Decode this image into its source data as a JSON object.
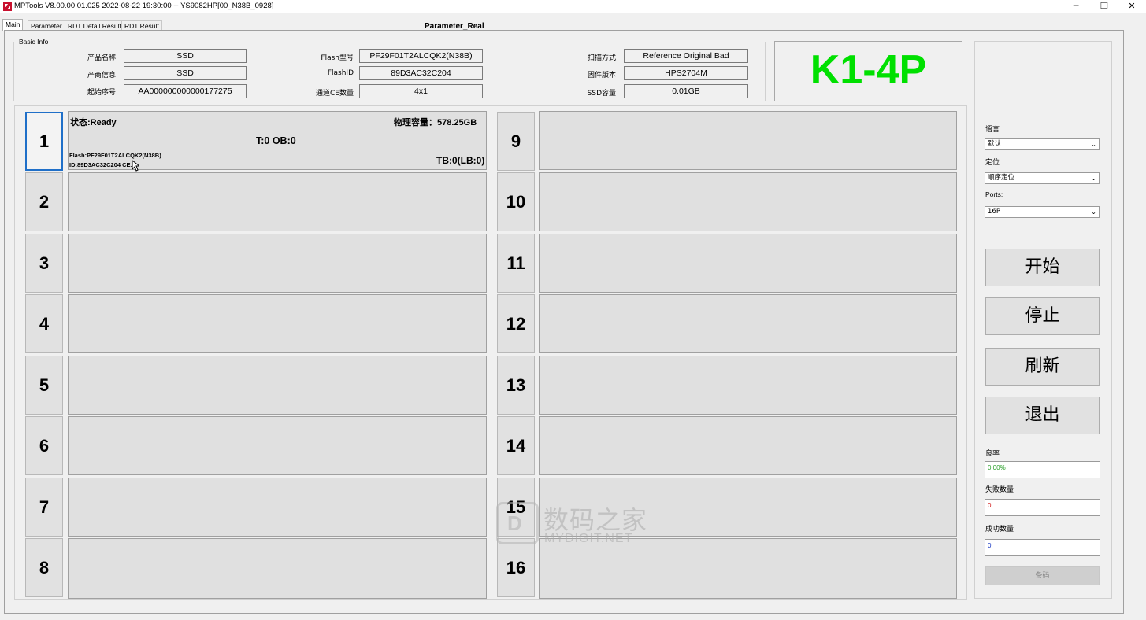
{
  "window": {
    "title": "MPTools V8.00.00.01.025 2022-08-22 19:30:00  -- YS9082HP[00_N38B_0928]",
    "minimize": "─",
    "restore": "❐",
    "close": "✕"
  },
  "tabs": [
    {
      "label": "Main",
      "active": true
    },
    {
      "label": "Parameter",
      "active": false
    },
    {
      "label": "RDT Detail Result",
      "active": false
    },
    {
      "label": "RDT Result",
      "active": false
    }
  ],
  "param_title": "Parameter_Real",
  "basic_info": {
    "legend": "Basic Info",
    "fields": [
      {
        "label": "产品名称",
        "value": "SSD"
      },
      {
        "label": "产商信息",
        "value": "SSD"
      },
      {
        "label": "起始序号",
        "value": "AA000000000000177275"
      },
      {
        "label": "Flash型号",
        "value": "PF29F01T2ALCQK2(N38B)"
      },
      {
        "label": "FlashID",
        "value": "89D3AC32C204"
      },
      {
        "label": "通道CE数量",
        "value": "4x1"
      },
      {
        "label": "扫描方式",
        "value": "Reference Original Bad"
      },
      {
        "label": "固件版本",
        "value": "HPS2704M"
      },
      {
        "label": "SSD容量",
        "value": "0.01GB"
      }
    ]
  },
  "big_label": {
    "text": "K1-4P",
    "color": "#00e000"
  },
  "ports": {
    "numbers": [
      "1",
      "2",
      "3",
      "4",
      "5",
      "6",
      "7",
      "8",
      "9",
      "10",
      "11",
      "12",
      "13",
      "14",
      "15",
      "16"
    ],
    "port1": {
      "status": "状态:Ready",
      "capacity": "物理容量：578.25GB",
      "t_ob": "T:0 OB:0",
      "flash": "Flash:PF29F01T2ALCQK2(N38B)",
      "id": "ID:89D3AC32C204 CE:4",
      "tb": "TB:0(LB:0)"
    }
  },
  "right_panel": {
    "language_label": "语言",
    "language_value": "默认",
    "locate_label": "定位",
    "locate_value": "顺序定位",
    "ports_label": "Ports:",
    "ports_value": "16P",
    "buttons": {
      "start": "开始",
      "stop": "停止",
      "refresh": "刷新",
      "exit": "退出"
    },
    "yield_label": "良率",
    "yield_value": "0.00%",
    "yield_color": "#2aa02a",
    "fail_label": "失败数量",
    "fail_value": "0",
    "fail_color": "#d01010",
    "success_label": "成功数量",
    "success_value": "0",
    "success_color": "#1030c0",
    "barcode_label": "条码"
  },
  "watermark": {
    "cn": "数码之家",
    "en": "MYDIGIT.NET",
    "logo_letter": "D"
  }
}
